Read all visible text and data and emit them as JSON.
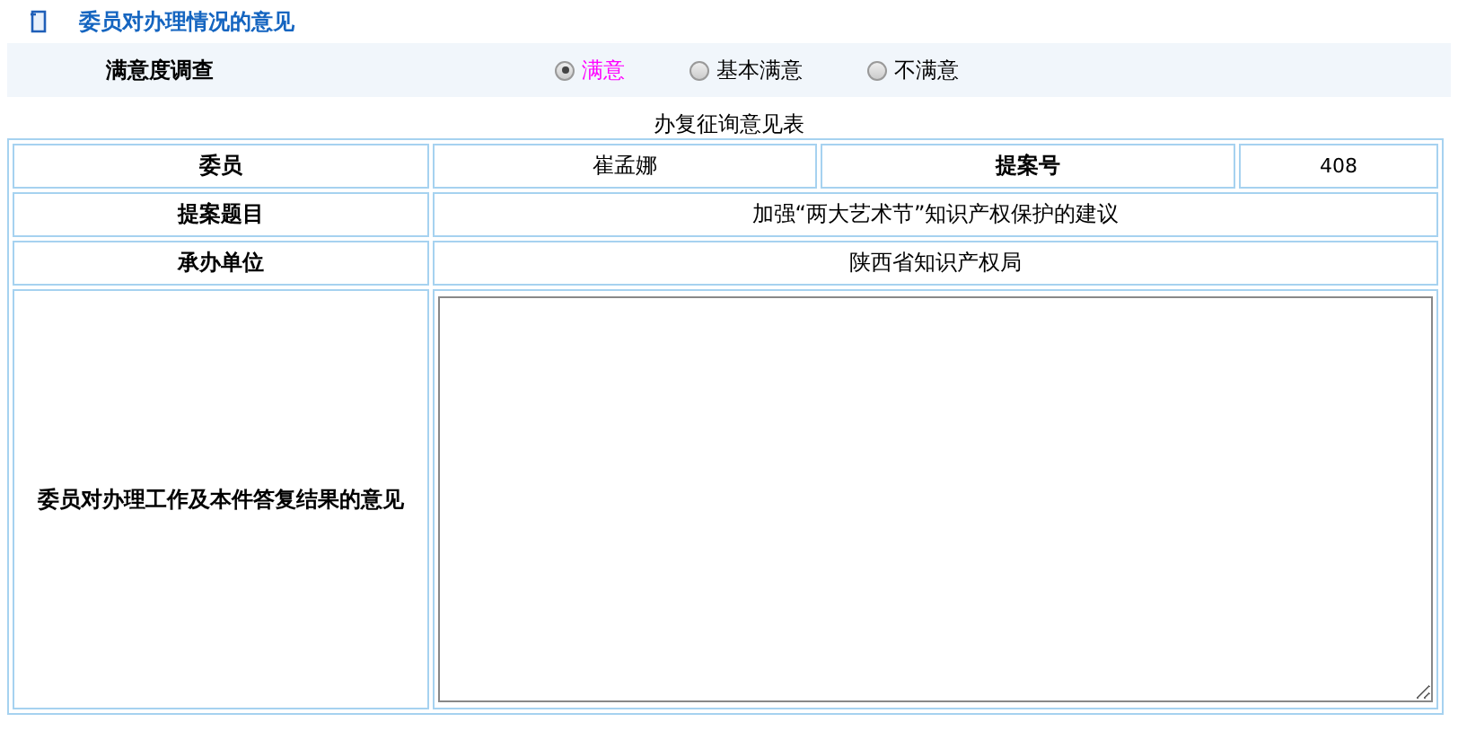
{
  "section_title": "委员对办理情况的意见",
  "survey": {
    "label": "满意度调查",
    "options": [
      {
        "label": "满意",
        "selected": true
      },
      {
        "label": "基本满意",
        "selected": false
      },
      {
        "label": "不满意",
        "selected": false
      }
    ]
  },
  "form": {
    "caption": "办复征询意见表",
    "member_label": "委员",
    "member": "崔孟娜",
    "proposal_no_label": "提案号",
    "proposal_no": "408",
    "topic_label": "提案题目",
    "topic": "加强“两大艺术节”知识产权保护的建议",
    "unit_label": "承办单位",
    "unit": "陕西省知识产权局",
    "opinion_label": "委员对办理工作及本件答复结果的意见"
  }
}
